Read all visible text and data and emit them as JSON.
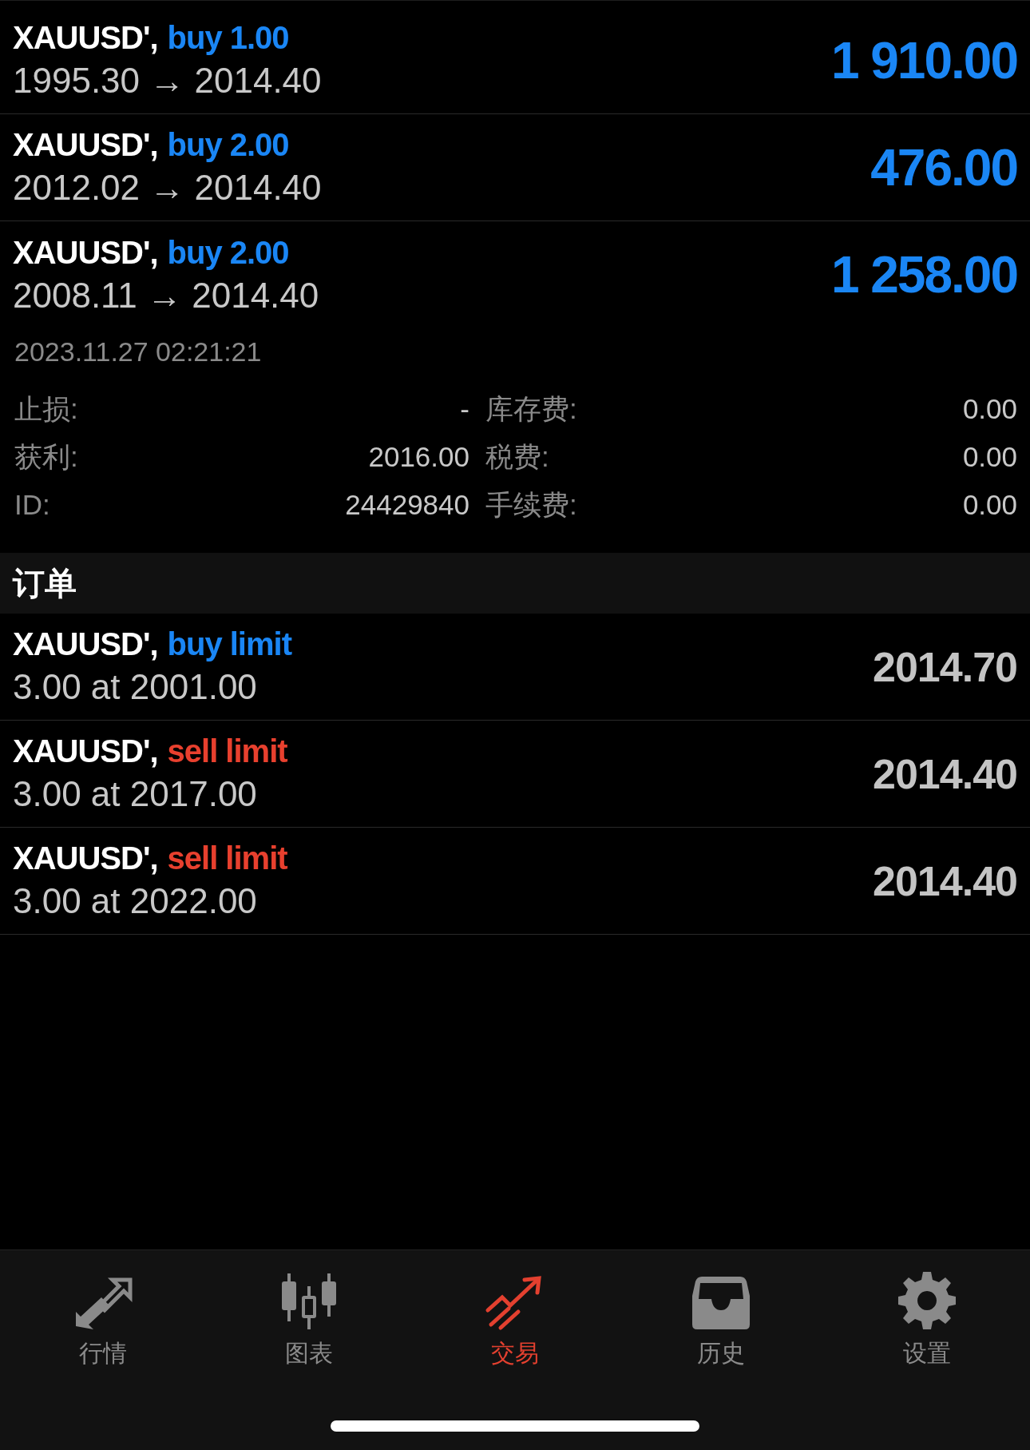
{
  "positions": [
    {
      "symbol": "XAUUSD',",
      "kind": "buy",
      "action": "buy 1.00",
      "prices": "1995.30 → 2014.40",
      "profit": "1 910.00",
      "expanded": false
    },
    {
      "symbol": "XAUUSD',",
      "kind": "buy",
      "action": "buy 2.00",
      "prices": "2012.02 → 2014.40",
      "profit": "476.00",
      "expanded": false
    },
    {
      "symbol": "XAUUSD',",
      "kind": "buy",
      "action": "buy 2.00",
      "prices": "2008.11 → 2014.40",
      "profit": "1 258.00",
      "expanded": true,
      "details": {
        "time": "2023.11.27 02:21:21",
        "rows": [
          {
            "label": "止损:",
            "value": "-",
            "label_2": "库存费:",
            "value_2": "0.00"
          },
          {
            "label": "获利:",
            "value": "2016.00",
            "label_2": "税费:",
            "value_2": "0.00"
          },
          {
            "label": "ID:",
            "value": "24429840",
            "label_2": "手续费:",
            "value_2": "0.00"
          }
        ]
      }
    }
  ],
  "orders_header": "订单",
  "orders": [
    {
      "symbol": "XAUUSD',",
      "kind": "buy",
      "action": "buy limit",
      "volume": "3.00 at 2001.00",
      "price": "2014.70"
    },
    {
      "symbol": "XAUUSD',",
      "kind": "sell",
      "action": "sell limit",
      "volume": "3.00 at 2017.00",
      "price": "2014.40"
    },
    {
      "symbol": "XAUUSD',",
      "kind": "sell",
      "action": "sell limit",
      "volume": "3.00 at 2022.00",
      "price": "2014.40"
    }
  ],
  "tabs": [
    {
      "kind": "quotes",
      "label": "行情",
      "selected": false
    },
    {
      "kind": "chart",
      "label": "图表",
      "selected": false
    },
    {
      "kind": "trade",
      "label": "交易",
      "selected": true
    },
    {
      "kind": "history",
      "label": "历史",
      "selected": false
    },
    {
      "kind": "settings",
      "label": "设置",
      "selected": false
    }
  ]
}
